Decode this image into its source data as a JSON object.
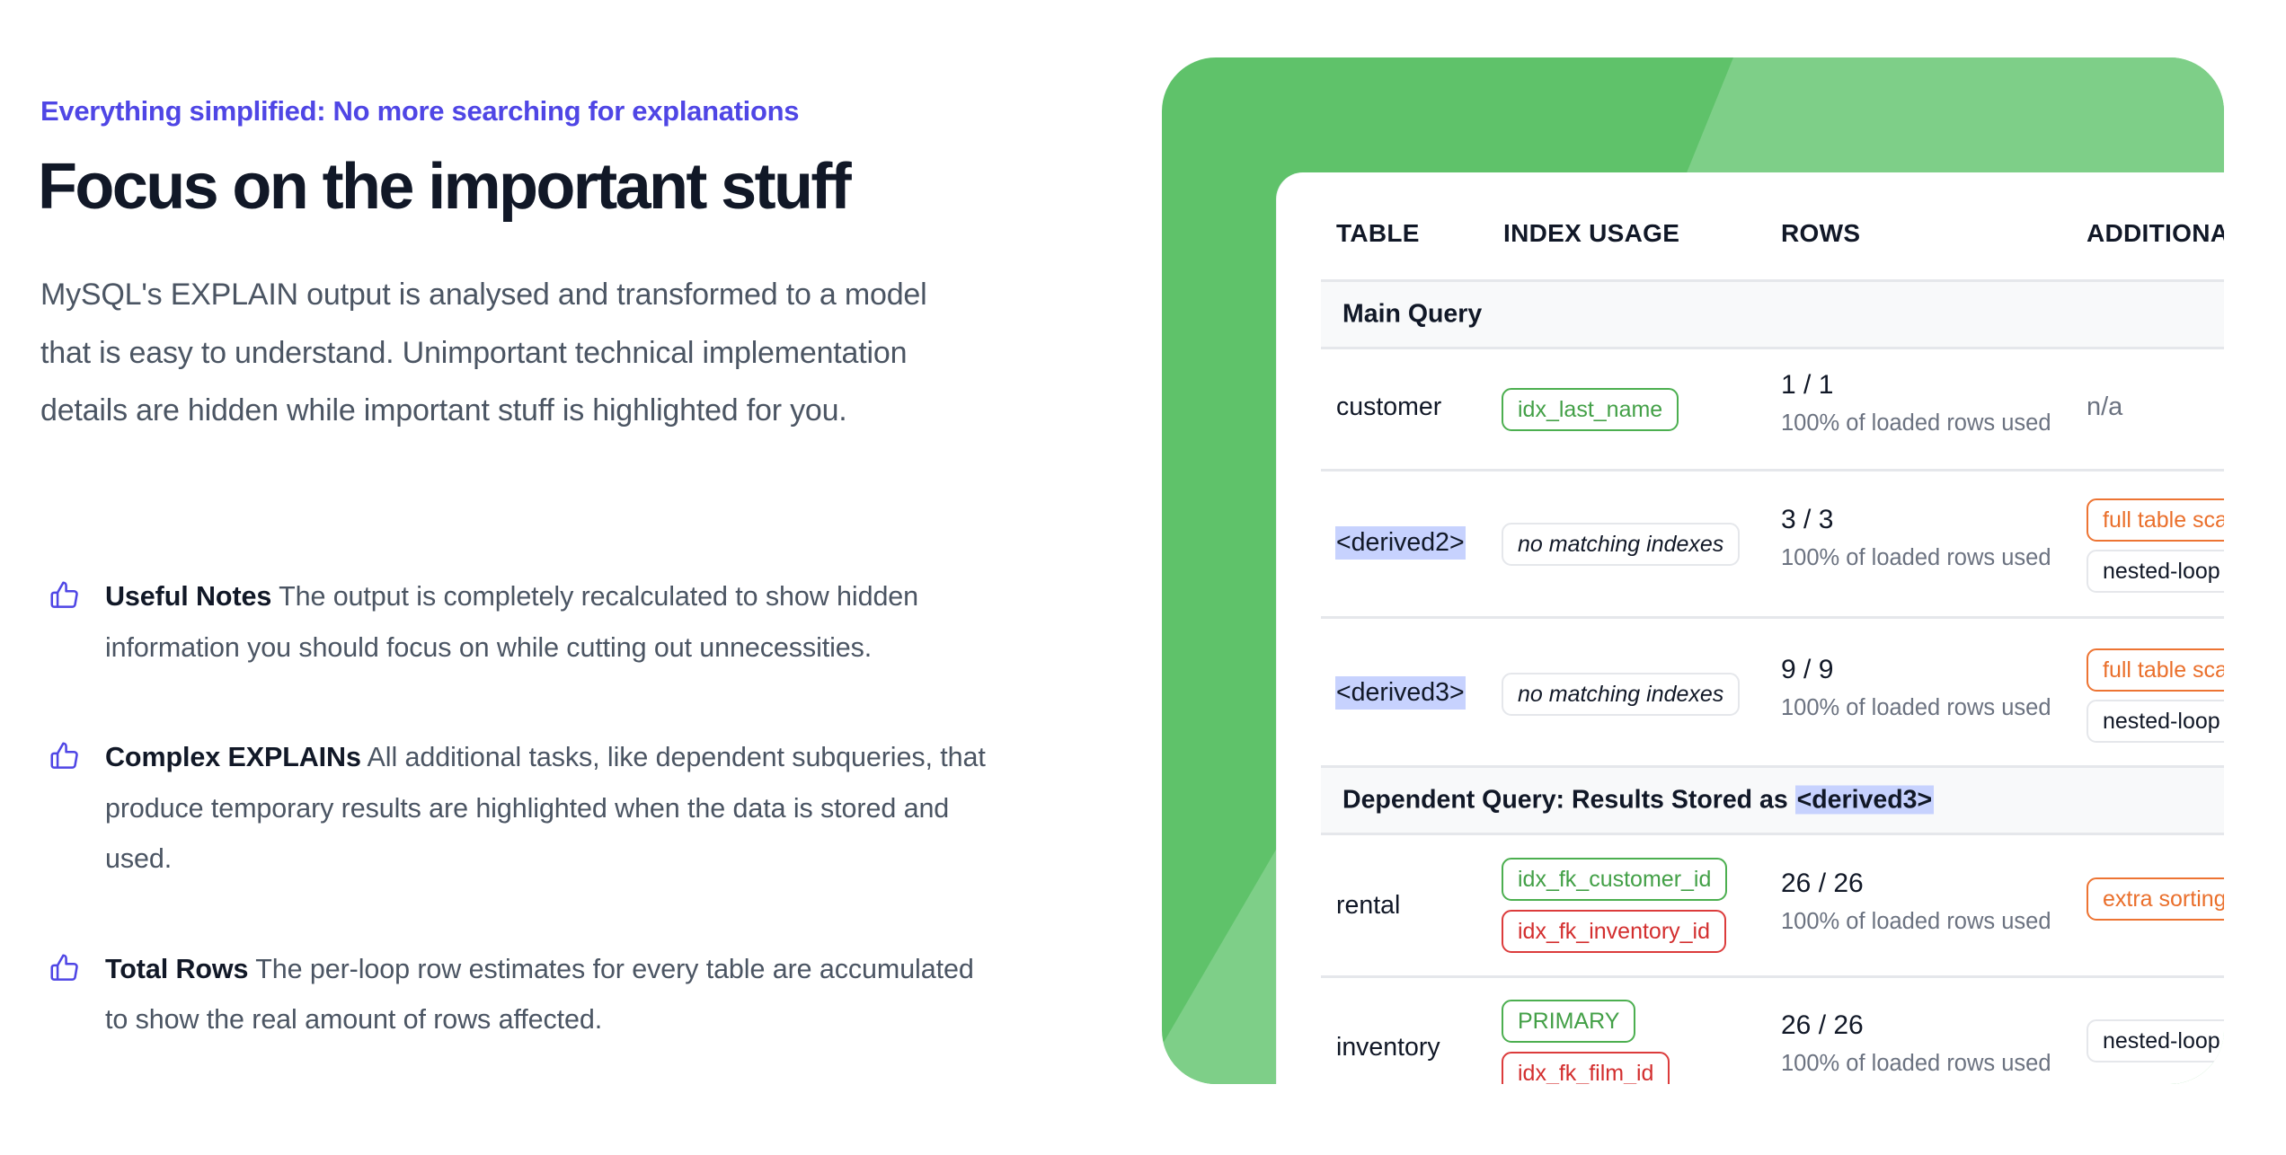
{
  "hero": {
    "eyebrow": "Everything simplified: No more searching for explanations",
    "title": "Focus on the important stuff",
    "lead": "MySQL's EXPLAIN output is analysed and transformed to a model that is easy to understand. Unimportant technical implementation details are hidden while important stuff is highlighted for you."
  },
  "features": [
    {
      "icon": "thumbs-up-icon",
      "name": "Useful Notes",
      "text": "The output is completely recalculated to show hidden information you should focus on while cutting out unnecessities."
    },
    {
      "icon": "thumbs-up-icon",
      "name": "Complex EXPLAINs",
      "text": "All additional tasks, like dependent subqueries, that produce temporary results are highlighted when the data is stored and used."
    },
    {
      "icon": "thumbs-up-icon",
      "name": "Total Rows",
      "text": "The per-loop row estimates for every table are accumulated to show the real amount of rows affected."
    }
  ],
  "colors": {
    "accent": "#4f46e5",
    "panel_dark_green": "#5fc26a",
    "panel_light_green": "#7ecf88",
    "badge_green": "#43a047",
    "badge_red": "#d32f2f",
    "badge_orange": "#ea6f2b",
    "highlight": "#c7d2fe"
  },
  "explain_table": {
    "headers": {
      "table": "TABLE",
      "index_usage": "INDEX USAGE",
      "rows": "ROWS",
      "additional": "ADDITIONA"
    },
    "groups": [
      {
        "label": "Main Query",
        "label_prefix": "",
        "label_highlight": ""
      },
      {
        "label": "",
        "label_prefix": "Dependent Query: Results Stored as ",
        "label_highlight": "<derived3>"
      }
    ],
    "rows": [
      {
        "table": "customer",
        "table_highlight": false,
        "indexes": [
          {
            "label": "idx_last_name",
            "status": "green"
          }
        ],
        "rows": "1 / 1",
        "rows_note": "100% of loaded rows used",
        "additional": [
          {
            "label": "n/a",
            "status": "plain"
          }
        ]
      },
      {
        "table": "<derived2>",
        "table_highlight": true,
        "indexes": [
          {
            "label": "no matching indexes",
            "status": "none"
          }
        ],
        "rows": "3 / 3",
        "rows_note": "100% of loaded rows used",
        "additional": [
          {
            "label": "full table scan",
            "status": "orange"
          },
          {
            "label": "nested-loop",
            "status": "gray"
          }
        ]
      },
      {
        "table": "<derived3>",
        "table_highlight": true,
        "indexes": [
          {
            "label": "no matching indexes",
            "status": "none"
          }
        ],
        "rows": "9 / 9",
        "rows_note": "100% of loaded rows used",
        "additional": [
          {
            "label": "full table scan",
            "status": "orange"
          },
          {
            "label": "nested-loop",
            "status": "gray"
          }
        ]
      },
      {
        "table": "rental",
        "table_highlight": false,
        "indexes": [
          {
            "label": "idx_fk_customer_id",
            "status": "green"
          },
          {
            "label": "idx_fk_inventory_id",
            "status": "red"
          }
        ],
        "rows": "26 / 26",
        "rows_note": "100% of loaded rows used",
        "additional": [
          {
            "label": "extra sorting",
            "status": "orange"
          }
        ]
      },
      {
        "table": "inventory",
        "table_highlight": false,
        "indexes": [
          {
            "label": "PRIMARY",
            "status": "green"
          },
          {
            "label": "idx_fk_film_id",
            "status": "red"
          }
        ],
        "rows": "26 / 26",
        "rows_note": "100% of loaded rows used",
        "additional": [
          {
            "label": "nested-loop",
            "status": "gray"
          }
        ]
      }
    ]
  }
}
